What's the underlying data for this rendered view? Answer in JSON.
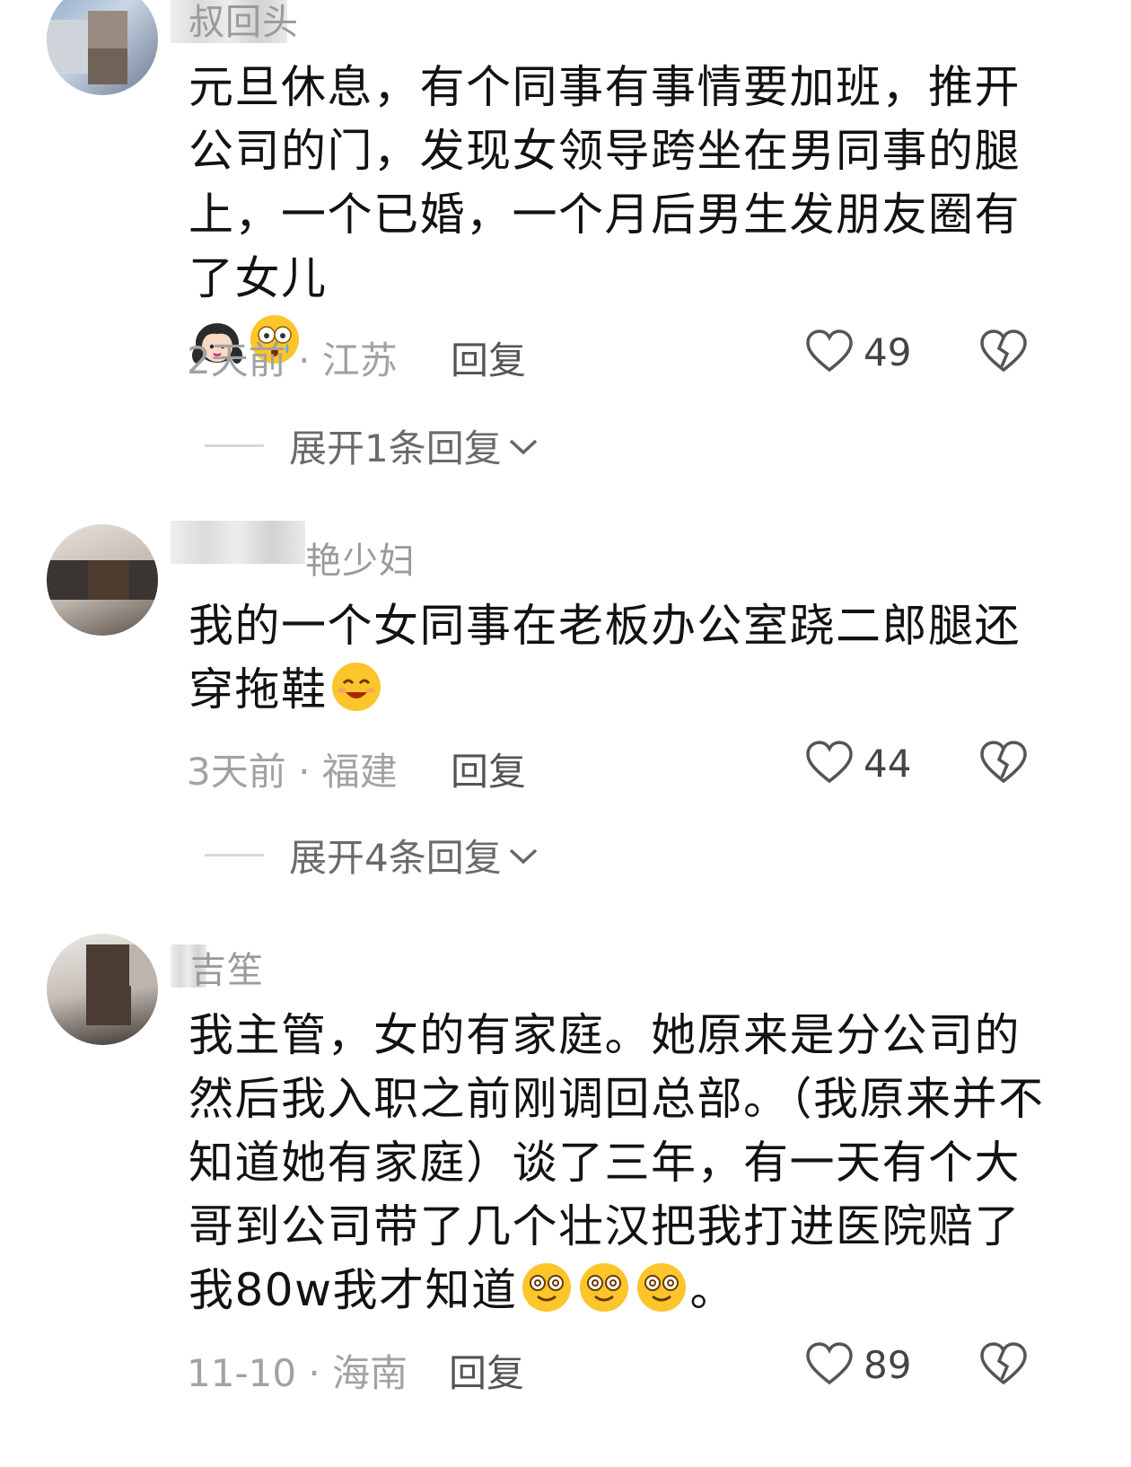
{
  "comments": [
    {
      "username": "叔回头",
      "text": "元旦休息，有个同事有事情要加班，推开公司的门，发现女领导跨坐在男同事的腿上，一个已婚，一个月后男生发朋友圈有了女儿",
      "emojis": [
        "girl-emoji",
        "shocked-face-emoji"
      ],
      "time": "2天前",
      "location": "江苏",
      "reply_label": "回复",
      "likes": "49",
      "expand_label": "展开1条回复"
    },
    {
      "username": "艳少妇",
      "text": "我的一个女同事在老板办公室跷二郎腿还穿拖鞋",
      "emojis": [
        "smiling-face-emoji"
      ],
      "time": "3天前",
      "location": "福建",
      "reply_label": "回复",
      "likes": "44",
      "expand_label": "展开4条回复"
    },
    {
      "username": "吉笙",
      "text": "我主管，女的有家庭。她原来是分公司的然后我入职之前刚调回总部。（我原来并不知道她有家庭）谈了三年，有一天有个大哥到公司带了几个壮汉把我打进医院赔了我80w我才知道",
      "text_end": "。",
      "emojis": [
        "dazed-face-emoji",
        "dazed-face-emoji",
        "dazed-face-emoji"
      ],
      "time": "11-10",
      "location": "海南",
      "reply_label": "回复",
      "likes": "89"
    }
  ],
  "meta_separator": " · ",
  "icons": {
    "like": "heart-outline-icon",
    "dislike": "broken-heart-icon",
    "expand": "chevron-down-icon"
  }
}
